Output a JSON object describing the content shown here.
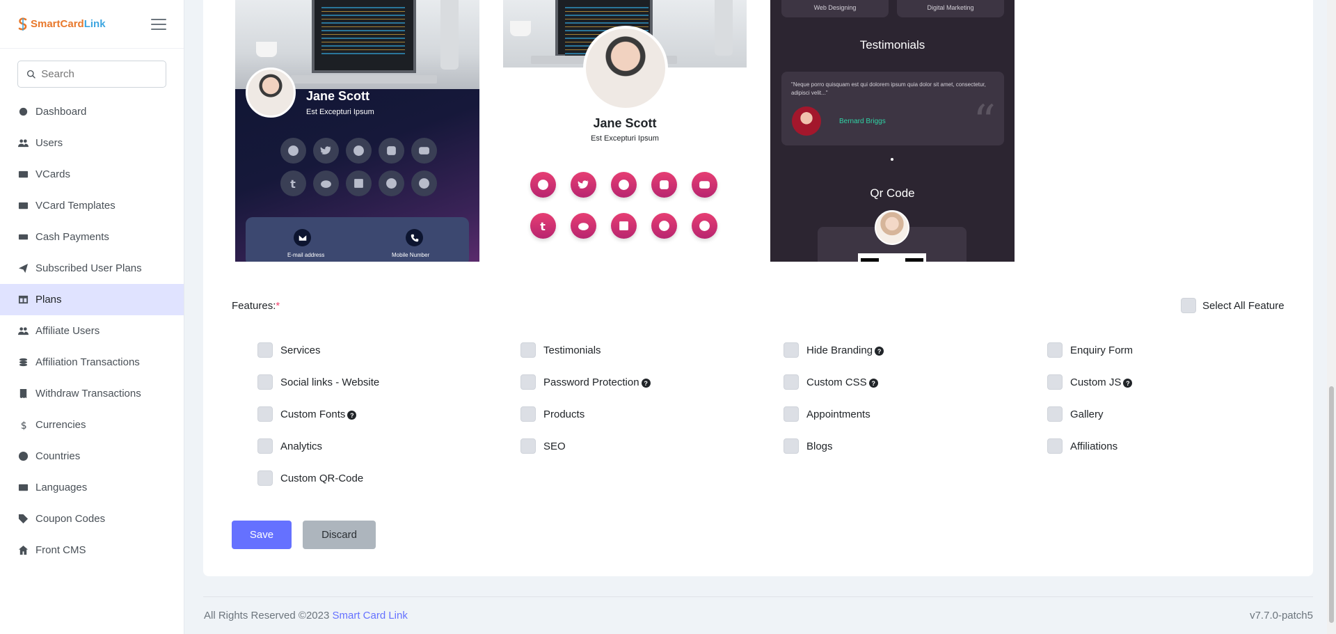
{
  "brand": {
    "smart": "Smart",
    "card": "Card",
    "link": "Link"
  },
  "search": {
    "placeholder": "Search"
  },
  "sidebar": {
    "items": [
      {
        "label": "Dashboard",
        "icon": "dashboard-icon"
      },
      {
        "label": "Users",
        "icon": "users-icon"
      },
      {
        "label": "VCards",
        "icon": "vcard-icon"
      },
      {
        "label": "VCard Templates",
        "icon": "vcard-template-icon"
      },
      {
        "label": "Cash Payments",
        "icon": "cash-icon"
      },
      {
        "label": "Subscribed User Plans",
        "icon": "paper-plane-icon"
      },
      {
        "label": "Plans",
        "icon": "plans-icon",
        "active": true
      },
      {
        "label": "Affiliate Users",
        "icon": "users-icon"
      },
      {
        "label": "Affiliation Transactions",
        "icon": "coins-icon"
      },
      {
        "label": "Withdraw Transactions",
        "icon": "receipt-icon"
      },
      {
        "label": "Currencies",
        "icon": "dollar-icon"
      },
      {
        "label": "Countries",
        "icon": "globe-icon"
      },
      {
        "label": "Languages",
        "icon": "language-icon"
      },
      {
        "label": "Coupon Codes",
        "icon": "tags-icon"
      },
      {
        "label": "Front CMS",
        "icon": "home-icon"
      }
    ]
  },
  "templates": {
    "t1": {
      "name": "Jane Scott",
      "subtitle": "Est Excepturi Ipsum",
      "email_label": "E-mail address",
      "phone_label": "Mobile Number"
    },
    "t2": {
      "name": "Jane Scott",
      "subtitle": "Est Excepturi Ipsum"
    },
    "t3": {
      "pill1": "Web Designing",
      "pill2": "Digital Marketing",
      "testimonials_title": "Testimonials",
      "quote": "\"Neque porro quisquam est qui dolorem ipsum quia dolor sit amet, consectetur, adipisci velit...\"",
      "author": "Bernard Briggs",
      "qr_title": "Qr Code"
    }
  },
  "features": {
    "label": "Features:",
    "required_mark": "*",
    "select_all": "Select All Feature",
    "items": [
      {
        "label": "Services",
        "help": false
      },
      {
        "label": "Testimonials",
        "help": false
      },
      {
        "label": "Hide Branding",
        "help": true
      },
      {
        "label": "Enquiry Form",
        "help": false
      },
      {
        "label": "Social links - Website",
        "help": false
      },
      {
        "label": "Password Protection",
        "help": true
      },
      {
        "label": "Custom CSS",
        "help": true
      },
      {
        "label": "Custom JS",
        "help": true
      },
      {
        "label": "Custom Fonts",
        "help": true
      },
      {
        "label": "Products",
        "help": false
      },
      {
        "label": "Appointments",
        "help": false
      },
      {
        "label": "Gallery",
        "help": false
      },
      {
        "label": "Analytics",
        "help": false
      },
      {
        "label": "SEO",
        "help": false
      },
      {
        "label": "Blogs",
        "help": false
      },
      {
        "label": "Affiliations",
        "help": false
      },
      {
        "label": "Custom QR-Code",
        "help": false
      }
    ],
    "help_glyph": "?"
  },
  "actions": {
    "save": "Save",
    "discard": "Discard"
  },
  "footer": {
    "copyright": "All Rights Reserved ©2023 ",
    "link": "Smart Card Link",
    "version": "v7.7.0-patch5"
  },
  "colors": {
    "primary": "#6571ff",
    "active_bg": "#e0e3ff",
    "accent_pink": "#e63e73"
  }
}
